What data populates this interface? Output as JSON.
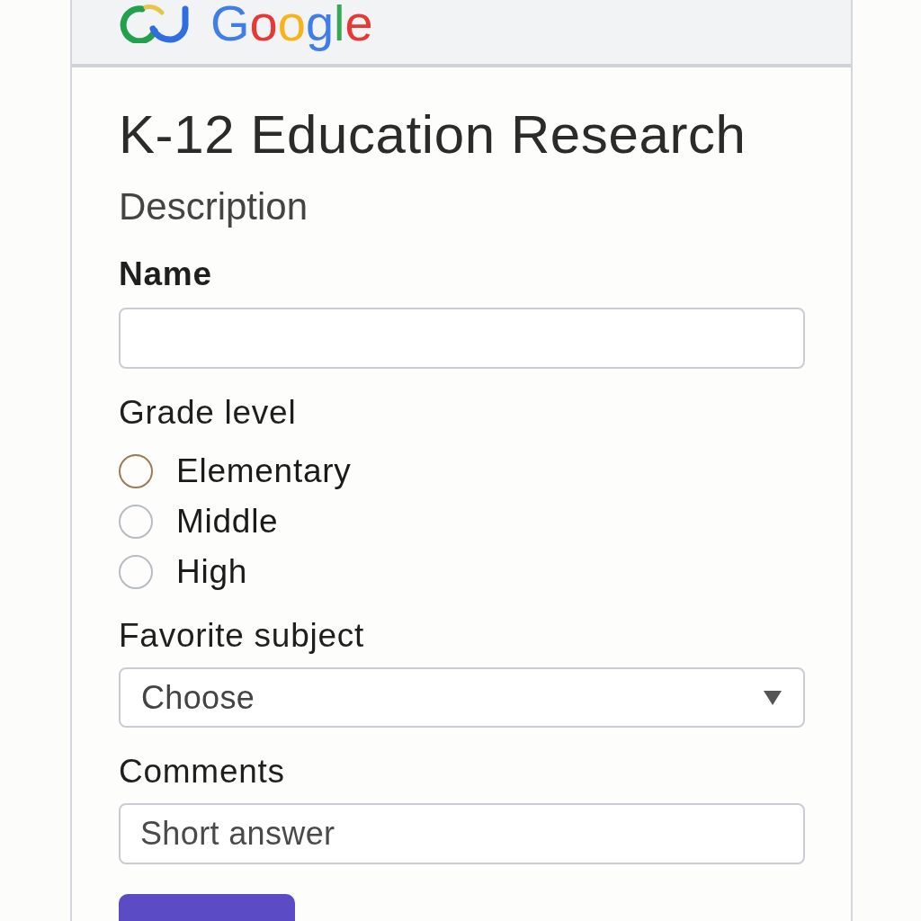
{
  "header": {
    "logo_text": "Google"
  },
  "form": {
    "title": "K-12 Education Research",
    "description": "Description",
    "questions": [
      {
        "kind": "text",
        "label": "Name",
        "bold": true
      },
      {
        "kind": "radio",
        "label": "Grade level",
        "bold": false,
        "options": [
          {
            "label": "Elementary",
            "selected": false,
            "color": "#9a7c55"
          },
          {
            "label": "Middle",
            "selected": false,
            "color": "#b7bcc3"
          },
          {
            "label": "High",
            "selected": false,
            "color": "#b7bcc3"
          }
        ]
      },
      {
        "kind": "dropdown",
        "label": "Favorite subject",
        "bold": false,
        "value": "Choose"
      },
      {
        "kind": "text",
        "label": "Comments",
        "bold": false,
        "placeholder": "Short answer"
      }
    ],
    "buttons": [
      {
        "kind": "primary"
      }
    ]
  }
}
